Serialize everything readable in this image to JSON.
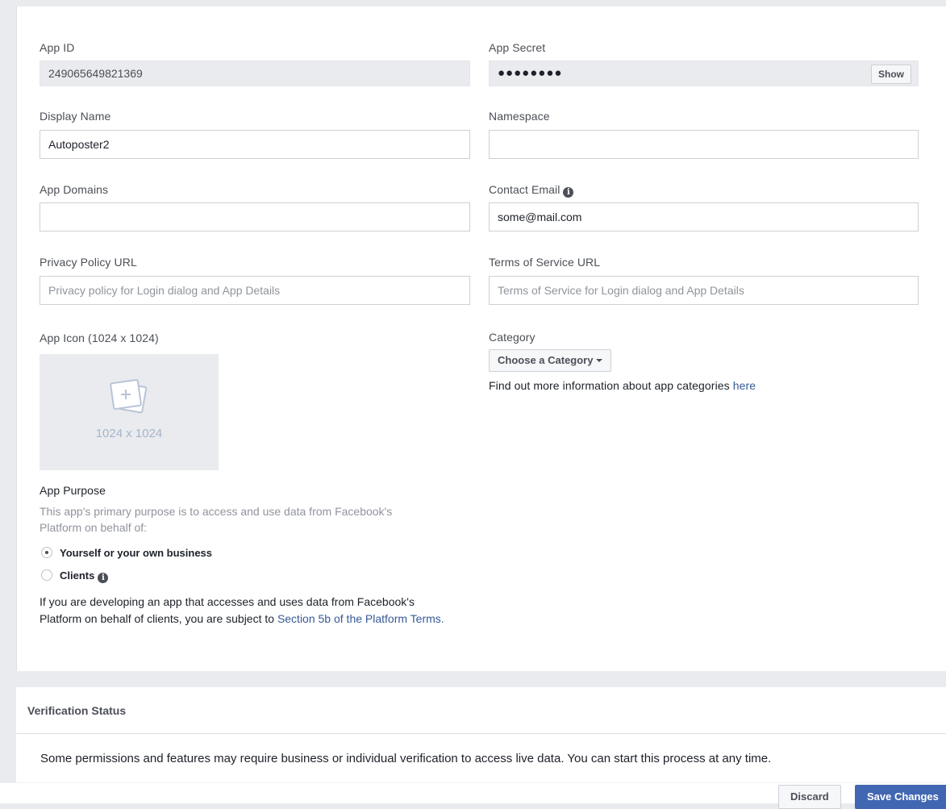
{
  "basic_settings": {
    "app_id": {
      "label": "App ID",
      "value": "249065649821369"
    },
    "app_secret": {
      "label": "App Secret",
      "value": "●●●●●●●●",
      "show_label": "Show"
    },
    "display_name": {
      "label": "Display Name",
      "value": "Autoposter2"
    },
    "namespace": {
      "label": "Namespace",
      "value": ""
    },
    "app_domains": {
      "label": "App Domains",
      "value": ""
    },
    "contact_email": {
      "label": "Contact Email",
      "value": "some@mail.com"
    },
    "privacy_policy_url": {
      "label": "Privacy Policy URL",
      "placeholder": "Privacy policy for Login dialog and App Details"
    },
    "terms_of_service_url": {
      "label": "Terms of Service URL",
      "placeholder": "Terms of Service for Login dialog and App Details"
    },
    "app_icon": {
      "label": "App Icon (1024 x 1024)",
      "placeholder_text": "1024 x 1024"
    },
    "category": {
      "label": "Category",
      "selected": "Choose a Category",
      "info_text": "Find out more information about app categories ",
      "info_link": "here"
    },
    "app_purpose": {
      "label": "App Purpose",
      "description": "This app's primary purpose is to access and use data from Facebook's Platform on behalf of:",
      "options": [
        {
          "label": "Yourself or your own business",
          "selected": true
        },
        {
          "label": "Clients",
          "selected": false
        }
      ],
      "terms_text": "If you are developing an app that accesses and uses data from Facebook's Platform on behalf of clients, you are subject to ",
      "terms_link": "Section 5b of the Platform Terms."
    }
  },
  "verification": {
    "title": "Verification Status",
    "text": "Some permissions and features may require business or individual verification to access live data. You can start this process at any time."
  },
  "footer": {
    "discard_label": "Discard",
    "save_label": "Save Changes"
  },
  "colors": {
    "link": "#365899",
    "primary_button": "#4267b2",
    "page_background": "#e9ebee"
  },
  "icons": [
    "info-icon",
    "image-add-icon",
    "caret-down-icon"
  ]
}
